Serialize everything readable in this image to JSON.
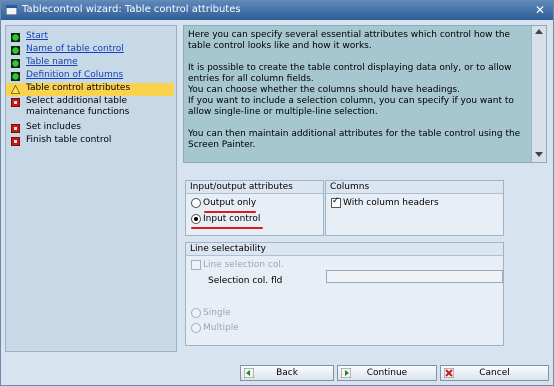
{
  "window": {
    "title": "Tablecontrol wizard: Table control attributes",
    "close_glyph": "✕"
  },
  "nav": {
    "items": [
      {
        "label": "Start",
        "icon": "green-circle-icon",
        "link": true
      },
      {
        "label": "Name of table control",
        "icon": "green-circle-icon",
        "link": true
      },
      {
        "label": "Table name",
        "icon": "green-circle-icon",
        "link": true
      },
      {
        "label": "Definition of Columns",
        "icon": "green-circle-icon",
        "link": true
      },
      {
        "label": "Table control attributes",
        "icon": "yellow-warning-icon",
        "link": false,
        "active": true
      },
      {
        "label": "Select additional table maintenance functions",
        "icon": "red-square-icon",
        "link": false
      },
      {
        "label": "Set includes",
        "icon": "red-square-icon",
        "link": false
      },
      {
        "label": "Finish table control",
        "icon": "red-square-icon",
        "link": false
      }
    ]
  },
  "info": {
    "paragraphs": [
      "Here you can specify several essential attributes which control how the table control looks like and how it works.",
      "It is possible to create the table control displaying data only, or to allow entries for all column fields.",
      "You can choose whether the columns should have headings.",
      "If you want to include a selection column, you can specify if you want to allow single-line or multiple-line selection.",
      "You can then maintain additional attributes for the table control using the Screen Painter."
    ]
  },
  "io_group": {
    "title": "Input/output attributes",
    "output_only": "Output only",
    "input_control": "Input control",
    "selected": "Input control"
  },
  "columns_group": {
    "title": "Columns",
    "with_headers": "With column headers",
    "with_headers_checked": true
  },
  "selectability_group": {
    "title": "Line selectability",
    "line_selection_col": "Line selection col.",
    "selection_col_fld": "Selection col. fld",
    "single": "Single",
    "multiple": "Multiple"
  },
  "buttons": {
    "back": "Back",
    "continue": "Continue",
    "cancel": "Cancel"
  },
  "colors": {
    "nav_link": "#1740b8",
    "active_item": "#fbd24e",
    "info_bg": "#a6c6d0",
    "annotation_red": "#d91c1c"
  }
}
